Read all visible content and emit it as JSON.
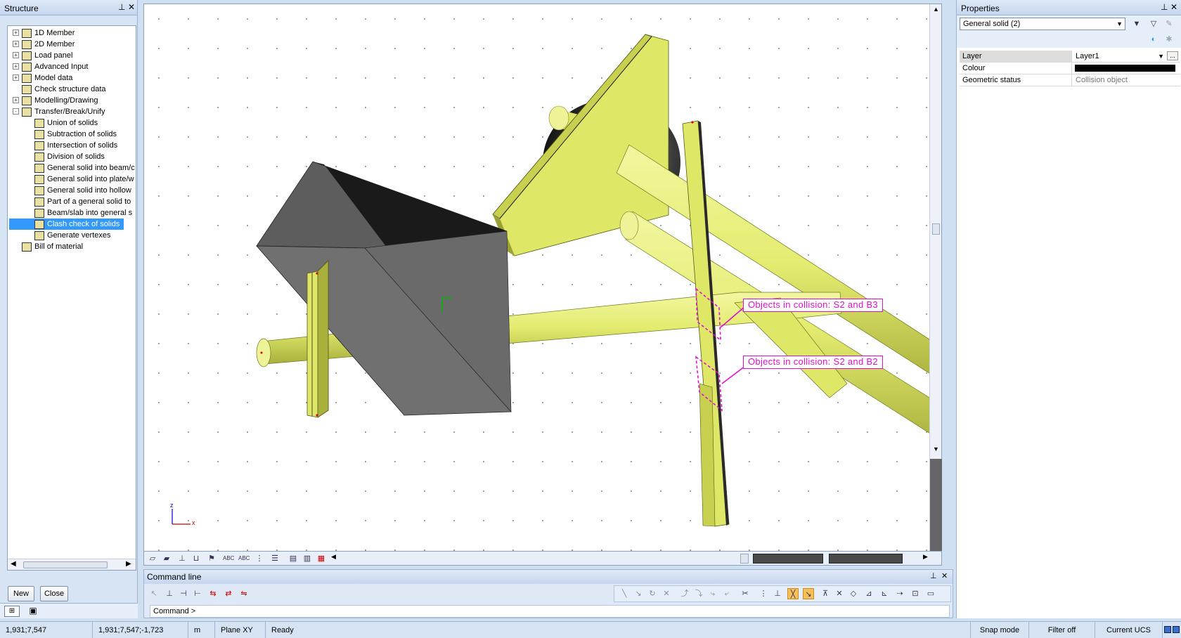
{
  "structure": {
    "title": "Structure",
    "items": [
      {
        "label": "1D Member",
        "level": 0,
        "expander": "+"
      },
      {
        "label": "2D Member",
        "level": 0,
        "expander": "+"
      },
      {
        "label": "Load panel",
        "level": 0,
        "expander": "+"
      },
      {
        "label": "Advanced Input",
        "level": 0,
        "expander": "+"
      },
      {
        "label": "Model data",
        "level": 0,
        "expander": "+"
      },
      {
        "label": "Check structure data",
        "level": 0,
        "expander": ""
      },
      {
        "label": "Modelling/Drawing",
        "level": 0,
        "expander": "+"
      },
      {
        "label": "Transfer/Break/Unify",
        "level": 0,
        "expander": "-"
      },
      {
        "label": "Union of solids",
        "level": 1
      },
      {
        "label": "Subtraction of solids",
        "level": 1
      },
      {
        "label": "Intersection of solids",
        "level": 1
      },
      {
        "label": "Division of solids",
        "level": 1
      },
      {
        "label": "General solid into beam/c",
        "level": 1
      },
      {
        "label": "General solid into plate/w",
        "level": 1
      },
      {
        "label": "General solid into hollow",
        "level": 1
      },
      {
        "label": "Part of a general solid to",
        "level": 1
      },
      {
        "label": "Beam/slab into general s",
        "level": 1
      },
      {
        "label": "Clash check of solids",
        "level": 1,
        "selected": true
      },
      {
        "label": "Generate vertexes",
        "level": 1
      },
      {
        "label": "Bill of material",
        "level": 0,
        "expander": ""
      }
    ],
    "new_label": "New",
    "close_label": "Close"
  },
  "properties": {
    "title": "Properties",
    "selector": "General solid (2)",
    "rows": [
      {
        "name": "Layer",
        "value": "Layer1"
      },
      {
        "name": "Colour",
        "value": ""
      },
      {
        "name": "Geometric status",
        "value": "Collision object"
      }
    ]
  },
  "viewport": {
    "collision_1": "Objects in collision: S2 and B3",
    "collision_2": "Objects in collision: S2 and B2",
    "axis_z": "z",
    "axis_x": "x"
  },
  "command": {
    "title": "Command line",
    "prompt": "Command >"
  },
  "status": {
    "coord1": "1,931;7,547",
    "coord2": "1,931;7,547;-1,723",
    "unit": "m",
    "plane": "Plane XY",
    "state": "Ready",
    "snap": "Snap mode",
    "filter": "Filter off",
    "ucs": "Current UCS"
  },
  "colors": {
    "solid_yellow": "#e3ec6f",
    "solid_yellow_side": "#9aa235",
    "solid_grey": "#6b6b6b",
    "collision": "#e010d0",
    "selection": "#3399ff"
  }
}
